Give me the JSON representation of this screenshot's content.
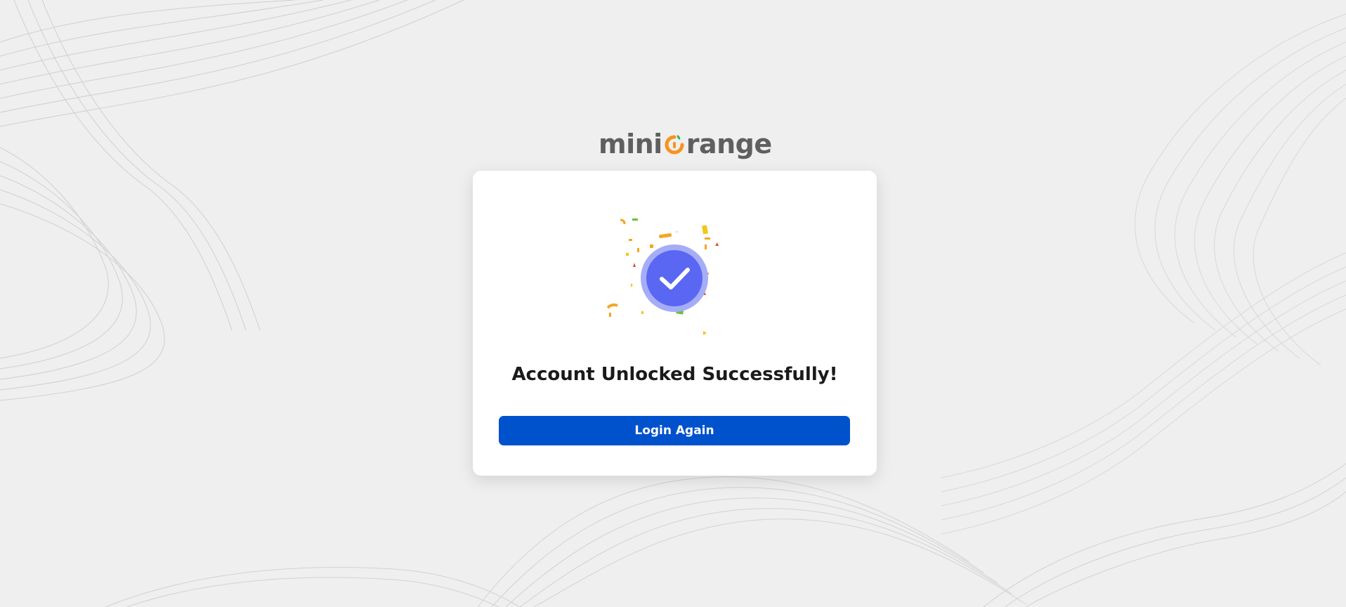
{
  "brand": {
    "logo_label": "miniOrange",
    "logo_part1": "mini",
    "logo_part2": "range",
    "colors": {
      "logo_text": "#5f5f5f",
      "logo_accent": "#f7931e",
      "logo_leaf": "#3cb54a"
    }
  },
  "card": {
    "status_icon": "check-circle-icon",
    "heading": "Account Unlocked Successfully!",
    "login_button_label": "Login Again"
  },
  "colors": {
    "page_background": "#efefef",
    "card_background": "#ffffff",
    "primary_button": "#0052cc",
    "check_circle": "#5a67f2",
    "check_halo": "#a5adf7",
    "heading_text": "#1a1a1a"
  }
}
